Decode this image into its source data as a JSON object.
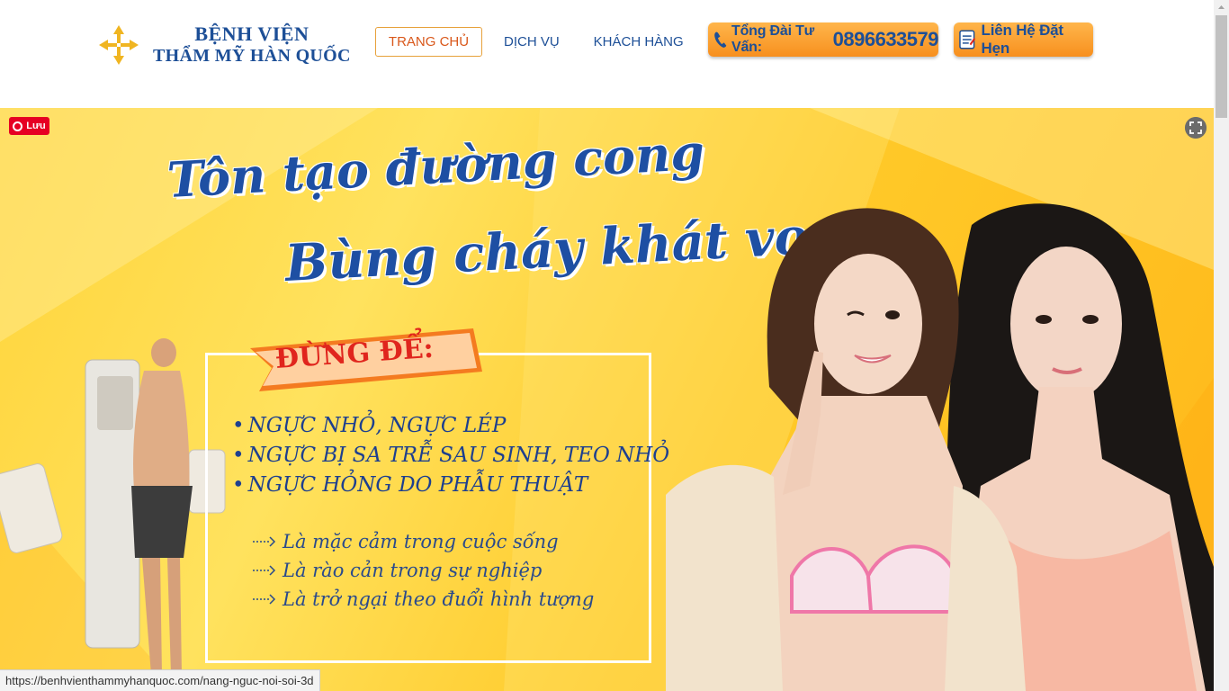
{
  "header": {
    "logo": {
      "icon": "cross-arrows-icon",
      "line1": "BỆNH VIỆN",
      "line2": "THẨM MỸ HÀN QUỐC"
    },
    "nav": [
      {
        "label": "TRANG CHỦ",
        "active": true
      },
      {
        "label": "DỊCH VỤ"
      },
      {
        "label": "KHÁCH HÀNG"
      }
    ],
    "hotline": {
      "icon": "phone-icon",
      "label": "Tổng Đài Tư Vấn:",
      "number": "0896633579"
    },
    "contact": {
      "icon": "notepad-icon",
      "label": "Liên Hệ Đặt Hẹn"
    }
  },
  "banner": {
    "pin_label": "Lưu",
    "headline_line1": "Tôn tạo đường cong",
    "headline_line2": "Bùng cháy khát vọng",
    "ribbon": "ĐỪNG ĐỂ:",
    "bullets": [
      "NGỰC NHỎ, NGỰC LÉP",
      "NGỰC BỊ SA TRỄ SAU SINH, TEO NHỎ",
      "NGỰC HỎNG DO PHẪU THUẬT"
    ],
    "subs": [
      "Là mặc cảm trong cuộc sống",
      "Là rào cản trong sự nghiệp",
      "Là trở ngại theo đuổi hình tượng"
    ]
  },
  "status_bar": {
    "url": "https://benhvienthammyhanquoc.com/nang-nguc-noi-soi-3d"
  },
  "colors": {
    "brand_blue": "#1d4f97",
    "accent_orange": "#f78f1e",
    "banner_yellow": "#ffd43a",
    "ribbon_red": "#e0251d"
  }
}
